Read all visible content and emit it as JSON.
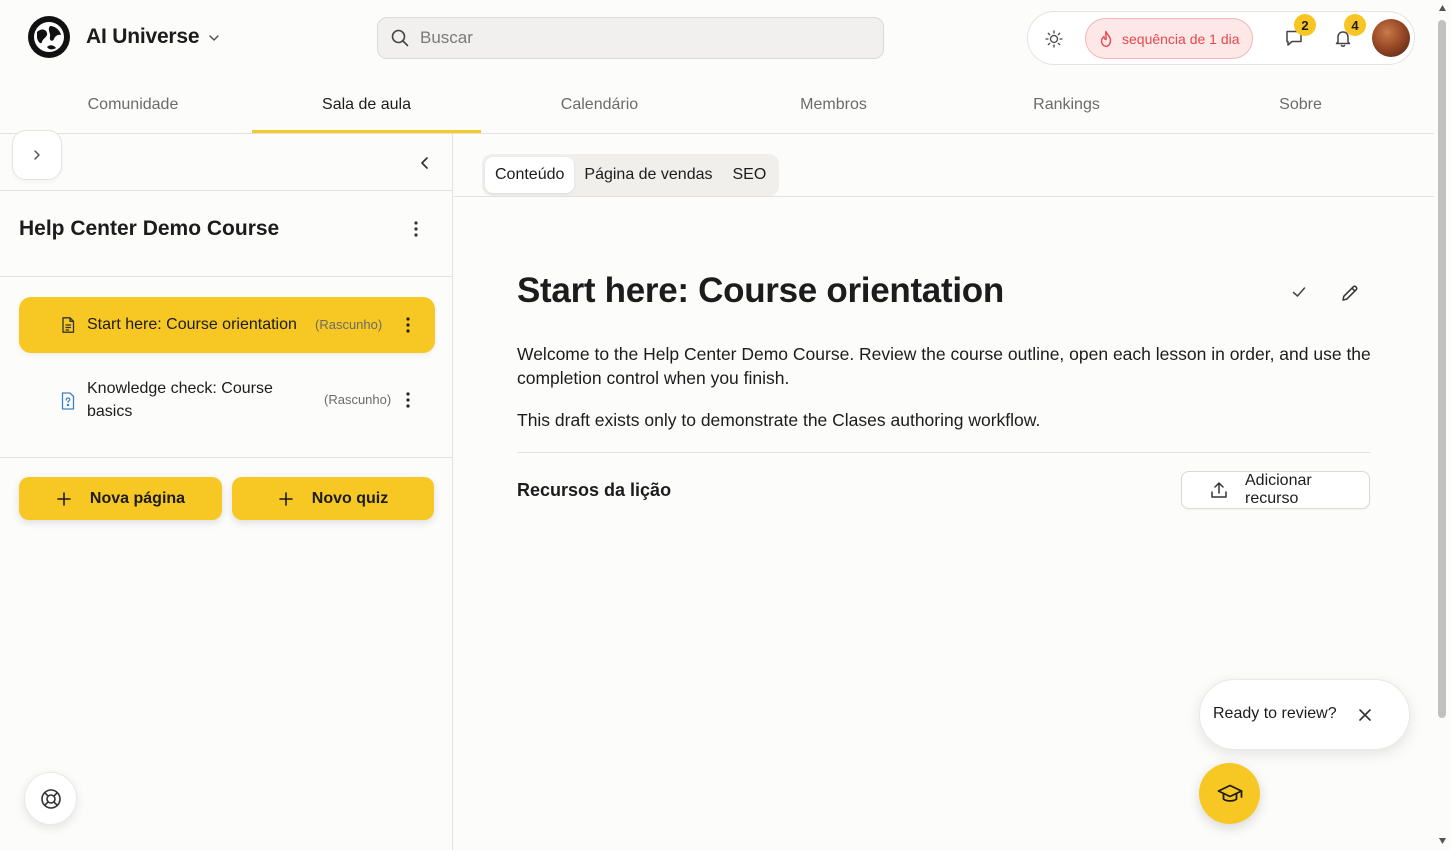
{
  "header": {
    "brand_name": "AI Universe",
    "search_placeholder": "Buscar",
    "streak_label": "sequência de 1 dia",
    "messages_badge": "2",
    "notifications_badge": "4"
  },
  "nav": {
    "tabs": [
      {
        "label": "Comunidade",
        "active": false
      },
      {
        "label": "Sala de aula",
        "active": true
      },
      {
        "label": "Calendário",
        "active": false
      },
      {
        "label": "Membros",
        "active": false
      },
      {
        "label": "Rankings",
        "active": false
      },
      {
        "label": "Sobre",
        "active": false
      }
    ]
  },
  "sidebar": {
    "course_title": "Help Center Demo Course",
    "lessons": [
      {
        "title": "Start here: Course orientation",
        "status": "(Rascunho)",
        "type": "page",
        "active": true
      },
      {
        "title": "Knowledge check: Course basics",
        "status": "(Rascunho)",
        "type": "quiz",
        "active": false
      }
    ],
    "new_page_label": "Nova página",
    "new_quiz_label": "Novo quiz"
  },
  "main": {
    "subtabs": [
      {
        "label": "Conteúdo",
        "active": true
      },
      {
        "label": "Página de vendas",
        "active": false
      },
      {
        "label": "SEO",
        "active": false
      }
    ],
    "lesson_title": "Start here: Course orientation",
    "paragraphs": [
      "Welcome to the Help Center Demo Course. Review the course outline, open each lesson in order, and use the completion control when you finish.",
      "This draft exists only to demonstrate the Clases authoring workflow."
    ],
    "resources_label": "Recursos da lição",
    "add_resource_label": "Adicionar recurso"
  },
  "review_popup": {
    "text": "Ready to review?"
  },
  "colors": {
    "accent": "#f7c724",
    "streak_bg": "#fde7e7",
    "streak_text": "#e5484d",
    "background": "#fcfcfb"
  },
  "icons": {
    "brand": "globe-logo-icon",
    "search": "search-icon",
    "theme": "sun-icon",
    "streak": "flame-icon",
    "messages": "chat-icon",
    "notifications": "bell-icon",
    "lesson_page": "document-icon",
    "lesson_quiz": "quiz-icon",
    "help": "lifebuoy-icon",
    "fab": "graduation-cap-icon"
  }
}
